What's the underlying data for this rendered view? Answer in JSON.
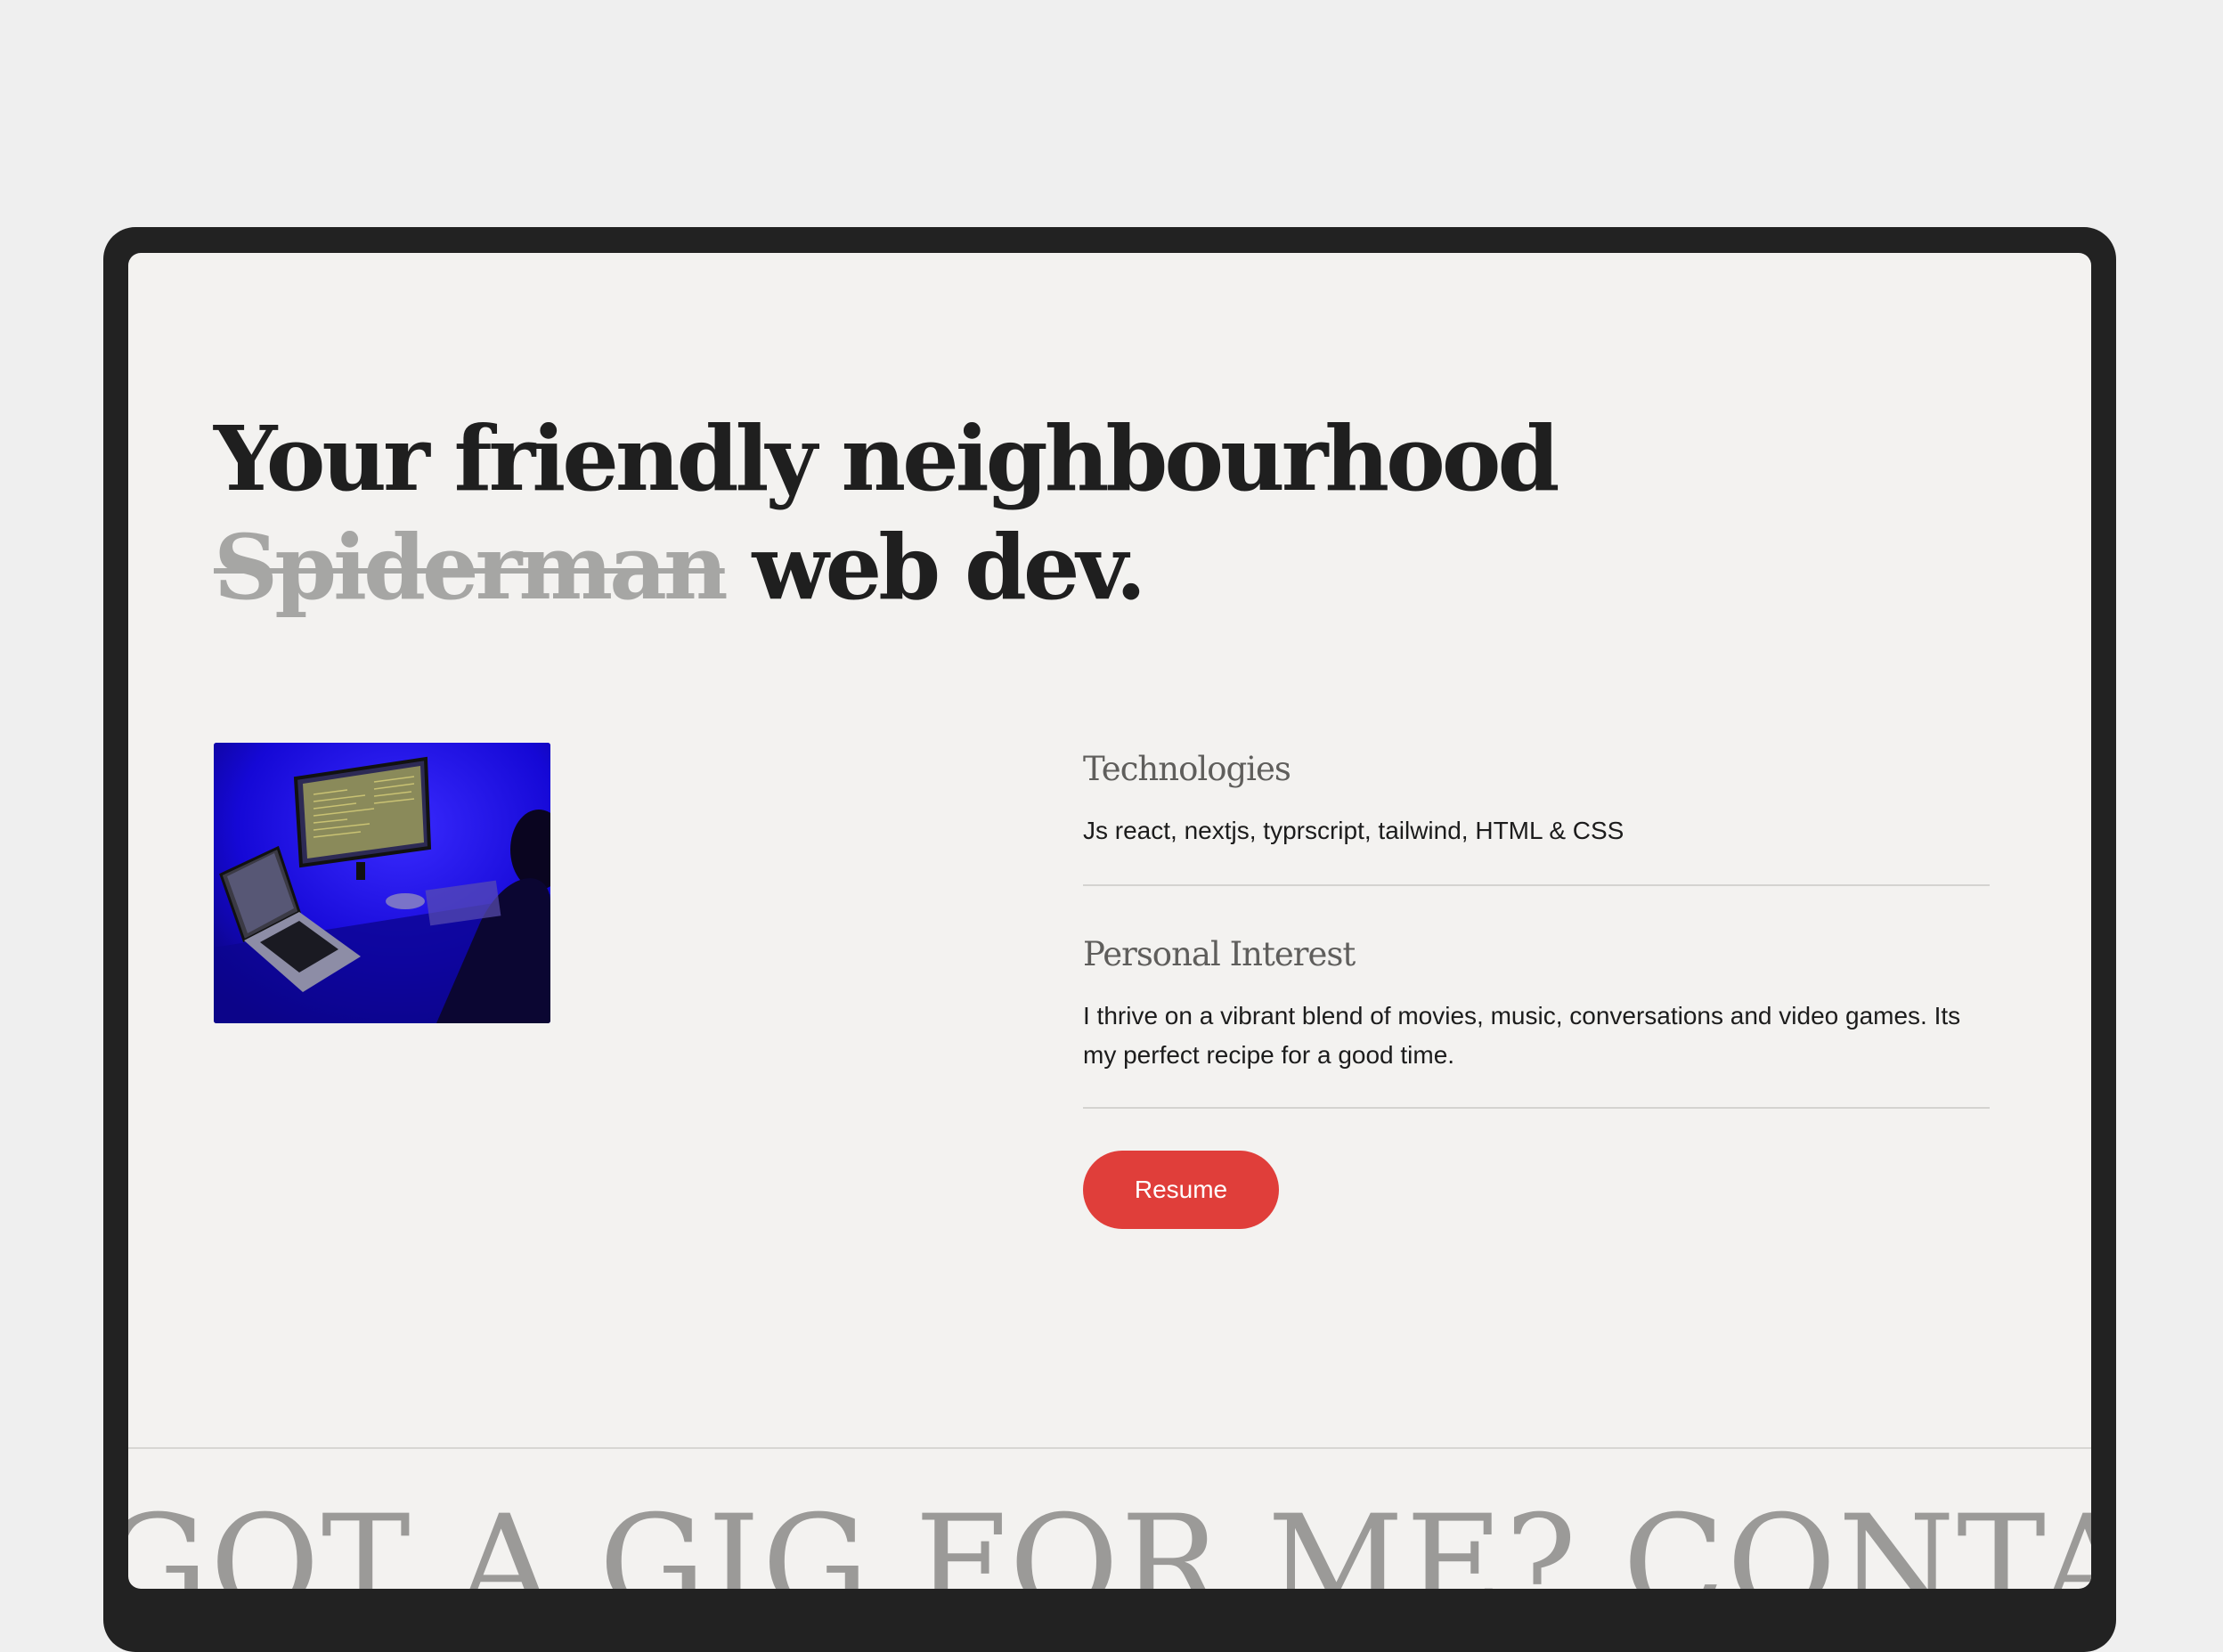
{
  "hero": {
    "line1": "Your friendly neighbourhood",
    "struck_word": "Spiderman",
    "line2_rest": "web dev."
  },
  "photo": {
    "description_icon": "desk-setup-photo"
  },
  "technologies": {
    "title": "Technologies",
    "text": "Js react, nextjs, typrscript, tailwind, HTML & CSS"
  },
  "interests": {
    "title": "Personal Interest",
    "text": "I thrive on a vibrant blend of movies, music, conversations and video games. Its my perfect recipe for a good time."
  },
  "resume_button": {
    "label": "Resume"
  },
  "marquee": {
    "text": "GOT A GIG FOR ME?   CONTACT ME"
  },
  "colors": {
    "page_background": "#efefef",
    "frame": "#222222",
    "screen": "#f3f2f0",
    "accent": "#e03e3a",
    "heading": "#1f1f1f",
    "muted": "#a6a6a4"
  }
}
